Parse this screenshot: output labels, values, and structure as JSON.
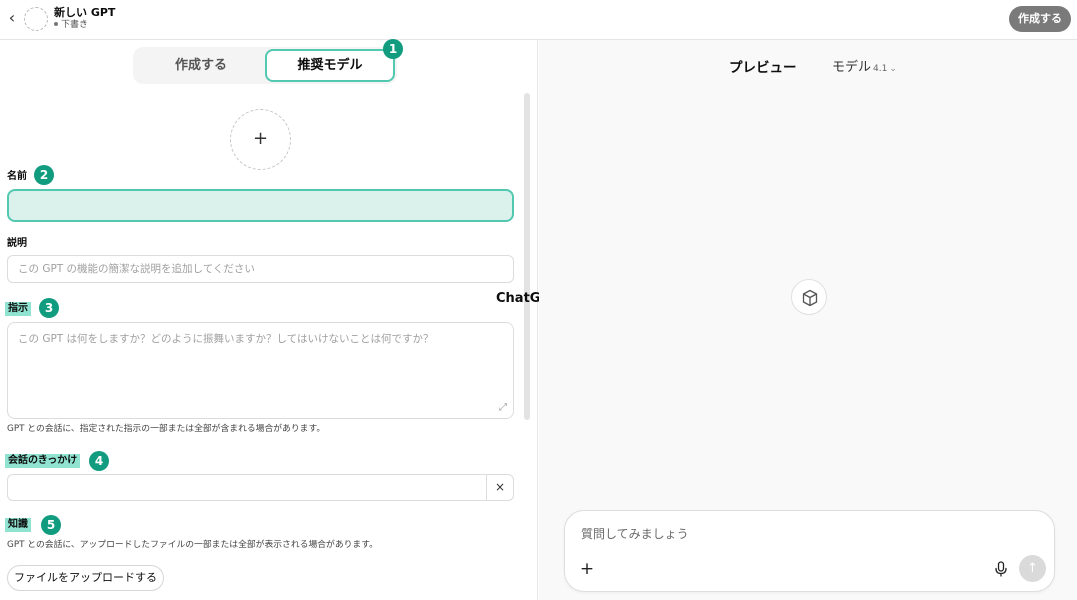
{
  "header": {
    "back_icon": "chevron-left-icon",
    "title": "新しい GPT",
    "status": "下書き",
    "create_button": "作成する"
  },
  "tabs": {
    "create": "作成する",
    "recommended": "推奨モデル"
  },
  "badges": [
    "1",
    "2",
    "3",
    "4",
    "5"
  ],
  "form": {
    "image_upload_icon": "+",
    "name_label": "名前",
    "name_value": "",
    "description_label": "説明",
    "description_placeholder": "この GPT の機能の簡潔な説明を追加してください",
    "instructions_label": "指示",
    "instructions_placeholder": "この GPT は何をしますか？どのように振舞いますか？してはいけないことは何ですか？",
    "instructions_help": "GPT との会話に、指定された指示の一部または全部が含まれる場合があります。",
    "starters_label": "会話のきっかけ",
    "starter_value": "",
    "starter_clear": "×",
    "knowledge_label": "知識",
    "knowledge_help": "GPT との会話に、アップロードしたファイルの一部または全部が表示される場合があります。",
    "upload_button": "ファイルをアップロードする"
  },
  "annotation": "ChatGPTの左",
  "preview": {
    "title": "プレビュー",
    "model_label": "モデル",
    "model_version": "4.1",
    "composer_placeholder": "質問してみましょう",
    "plus": "+",
    "send": "↑"
  },
  "colors": {
    "accent": "#52c8b0",
    "badge": "#119c80",
    "highlight": "#8fe3d0",
    "name_field_bg": "#dbf2ec",
    "create_button_bg": "#7a7a7a"
  }
}
